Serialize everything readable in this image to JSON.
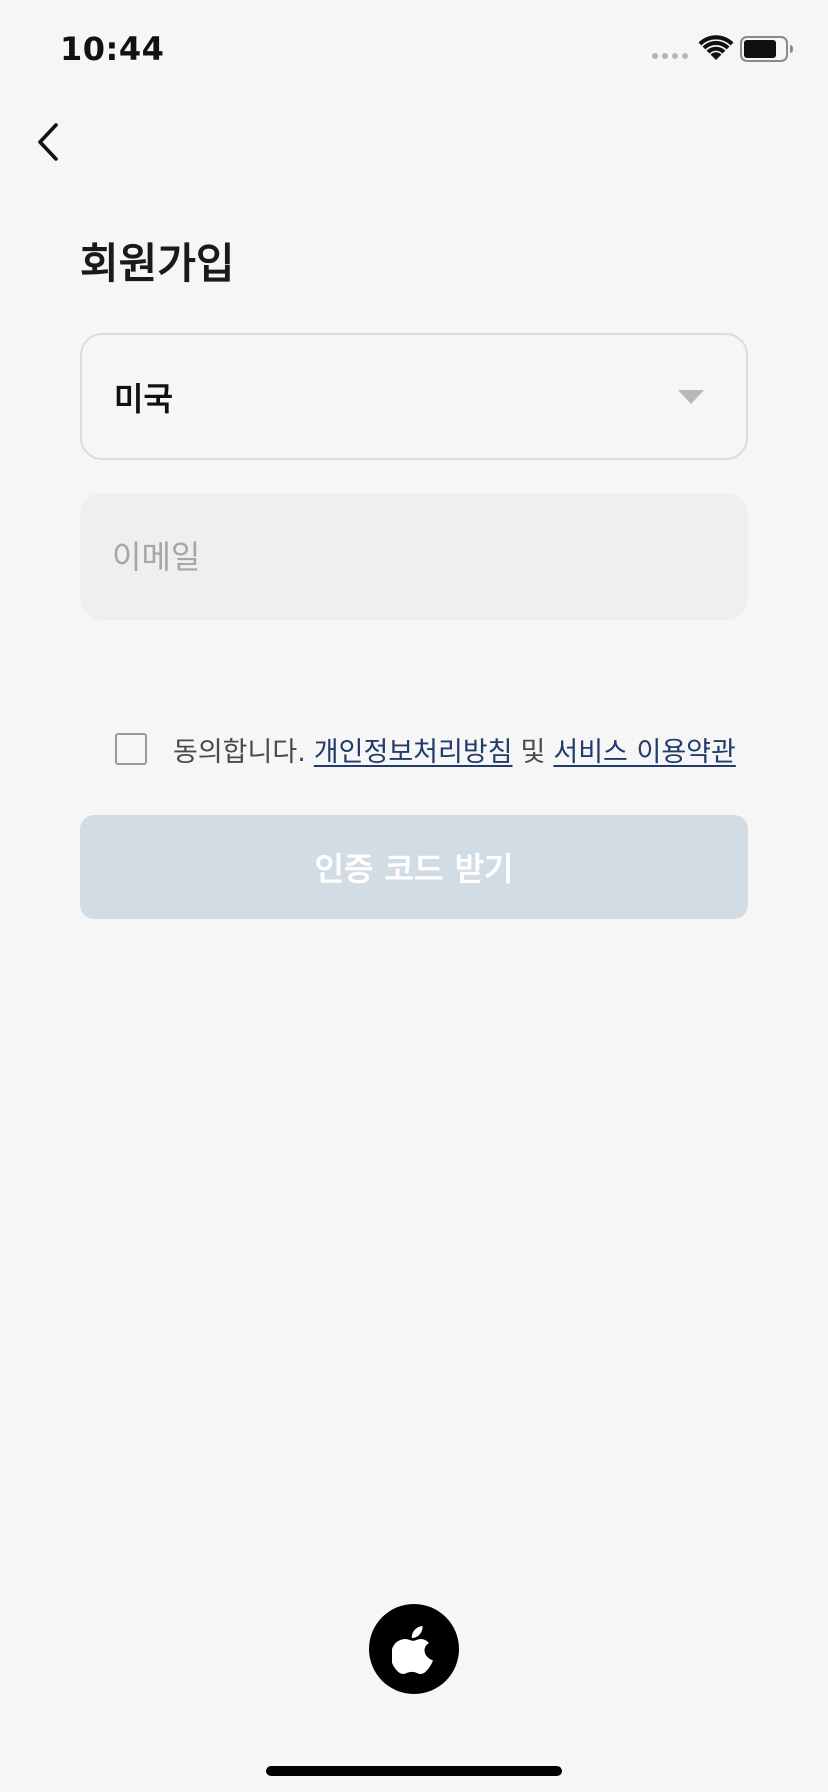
{
  "status_bar": {
    "time": "10:44"
  },
  "header": {
    "back_icon": "chevron-left-icon",
    "title": "회원가입"
  },
  "form": {
    "country_select": {
      "value": "미국",
      "icon": "chevron-down-icon"
    },
    "email": {
      "value": "",
      "placeholder": "이메일"
    },
    "agreement": {
      "checked": false,
      "prefix": "동의합니다.",
      "privacy_link": "개인정보처리방침",
      "separator": "및",
      "terms_link": "서비스 이용약관"
    },
    "submit_label": "인증 코드 받기"
  },
  "social_login": {
    "apple_icon": "apple-icon"
  },
  "colors": {
    "background": "#f6f6f6",
    "submit_disabled": "#d2dce4",
    "link": "#233b6b",
    "input_fill": "#efefef"
  }
}
